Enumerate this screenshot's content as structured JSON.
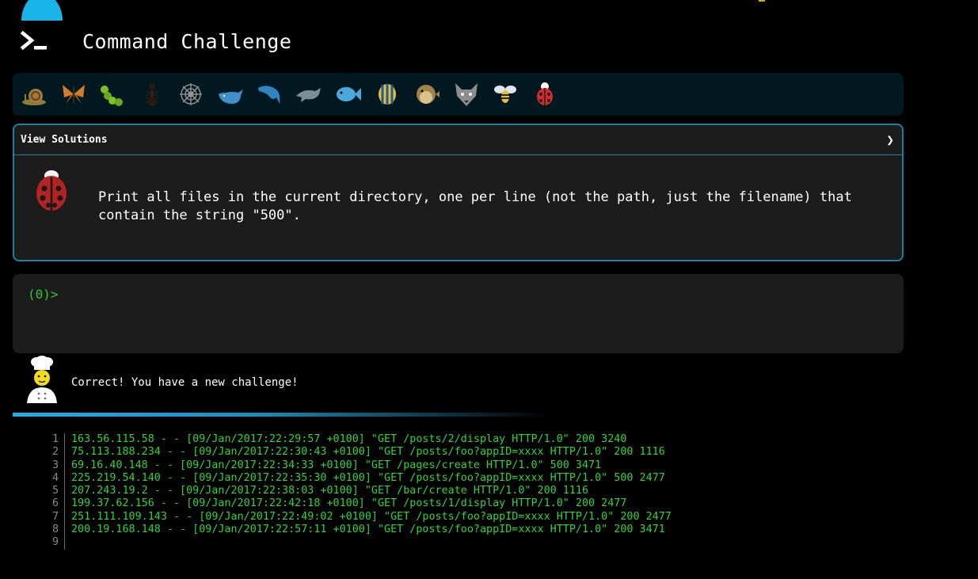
{
  "app": {
    "title": "Command Challenge",
    "logo_icon": "terminal-prompt-icon",
    "accent": "#19b5e8"
  },
  "animals": [
    {
      "name": "snail",
      "icon": "snail-icon"
    },
    {
      "name": "butterfly",
      "icon": "butterfly-icon"
    },
    {
      "name": "caterpillar",
      "icon": "caterpillar-icon"
    },
    {
      "name": "ant",
      "icon": "ant-icon"
    },
    {
      "name": "spider-web",
      "icon": "spider-web-icon"
    },
    {
      "name": "whale",
      "icon": "whale-icon"
    },
    {
      "name": "dolphin",
      "icon": "dolphin-icon"
    },
    {
      "name": "dolphin-grey",
      "icon": "dolphin-grey-icon"
    },
    {
      "name": "fish",
      "icon": "fish-icon"
    },
    {
      "name": "tropical-fish",
      "icon": "tropical-fish-icon"
    },
    {
      "name": "blowfish",
      "icon": "blowfish-icon"
    },
    {
      "name": "wolf",
      "icon": "wolf-icon"
    },
    {
      "name": "bee",
      "icon": "bee-icon"
    },
    {
      "name": "ladybug",
      "icon": "ladybug-icon"
    }
  ],
  "challenge": {
    "view_solutions": "View Solutions",
    "chevron": "❯",
    "text": "Print all files in the current directory, one per line (not the path, just the filename) that contain the string \"500\"."
  },
  "terminal": {
    "prompt": "(0)>"
  },
  "message": {
    "text": "Correct! You have a new challenge!"
  },
  "file": {
    "lines": [
      {
        "n": "1",
        "text": "163.56.115.58 - - [09/Jan/2017:22:29:57 +0100] \"GET /posts/2/display HTTP/1.0\" 200 3240"
      },
      {
        "n": "2",
        "text": "75.113.188.234 - - [09/Jan/2017:22:30:43 +0100] \"GET /posts/foo?appID=xxxx HTTP/1.0\" 200 1116"
      },
      {
        "n": "3",
        "text": "69.16.40.148 - - [09/Jan/2017:22:34:33 +0100] \"GET /pages/create HTTP/1.0\" 500 3471"
      },
      {
        "n": "4",
        "text": "225.219.54.140 - - [09/Jan/2017:22:35:30 +0100] \"GET /posts/foo?appID=xxxx HTTP/1.0\" 500 2477"
      },
      {
        "n": "5",
        "text": "207.243.19.2 - - [09/Jan/2017:22:38:03 +0100] \"GET /bar/create HTTP/1.0\" 200 1116"
      },
      {
        "n": "6",
        "text": "199.37.62.156 - - [09/Jan/2017:22:42:18 +0100] \"GET /posts/1/display HTTP/1.0\" 200 2477"
      },
      {
        "n": "7",
        "text": "251.111.109.143 - - [09/Jan/2017:22:49:02 +0100] \"GET /posts/foo?appID=xxxx HTTP/1.0\" 200 2477"
      },
      {
        "n": "8",
        "text": "200.19.168.148 - - [09/Jan/2017:22:57:11 +0100] \"GET /posts/foo?appID=xxxx HTTP/1.0\" 200 3471"
      },
      {
        "n": "9",
        "text": ""
      }
    ]
  }
}
